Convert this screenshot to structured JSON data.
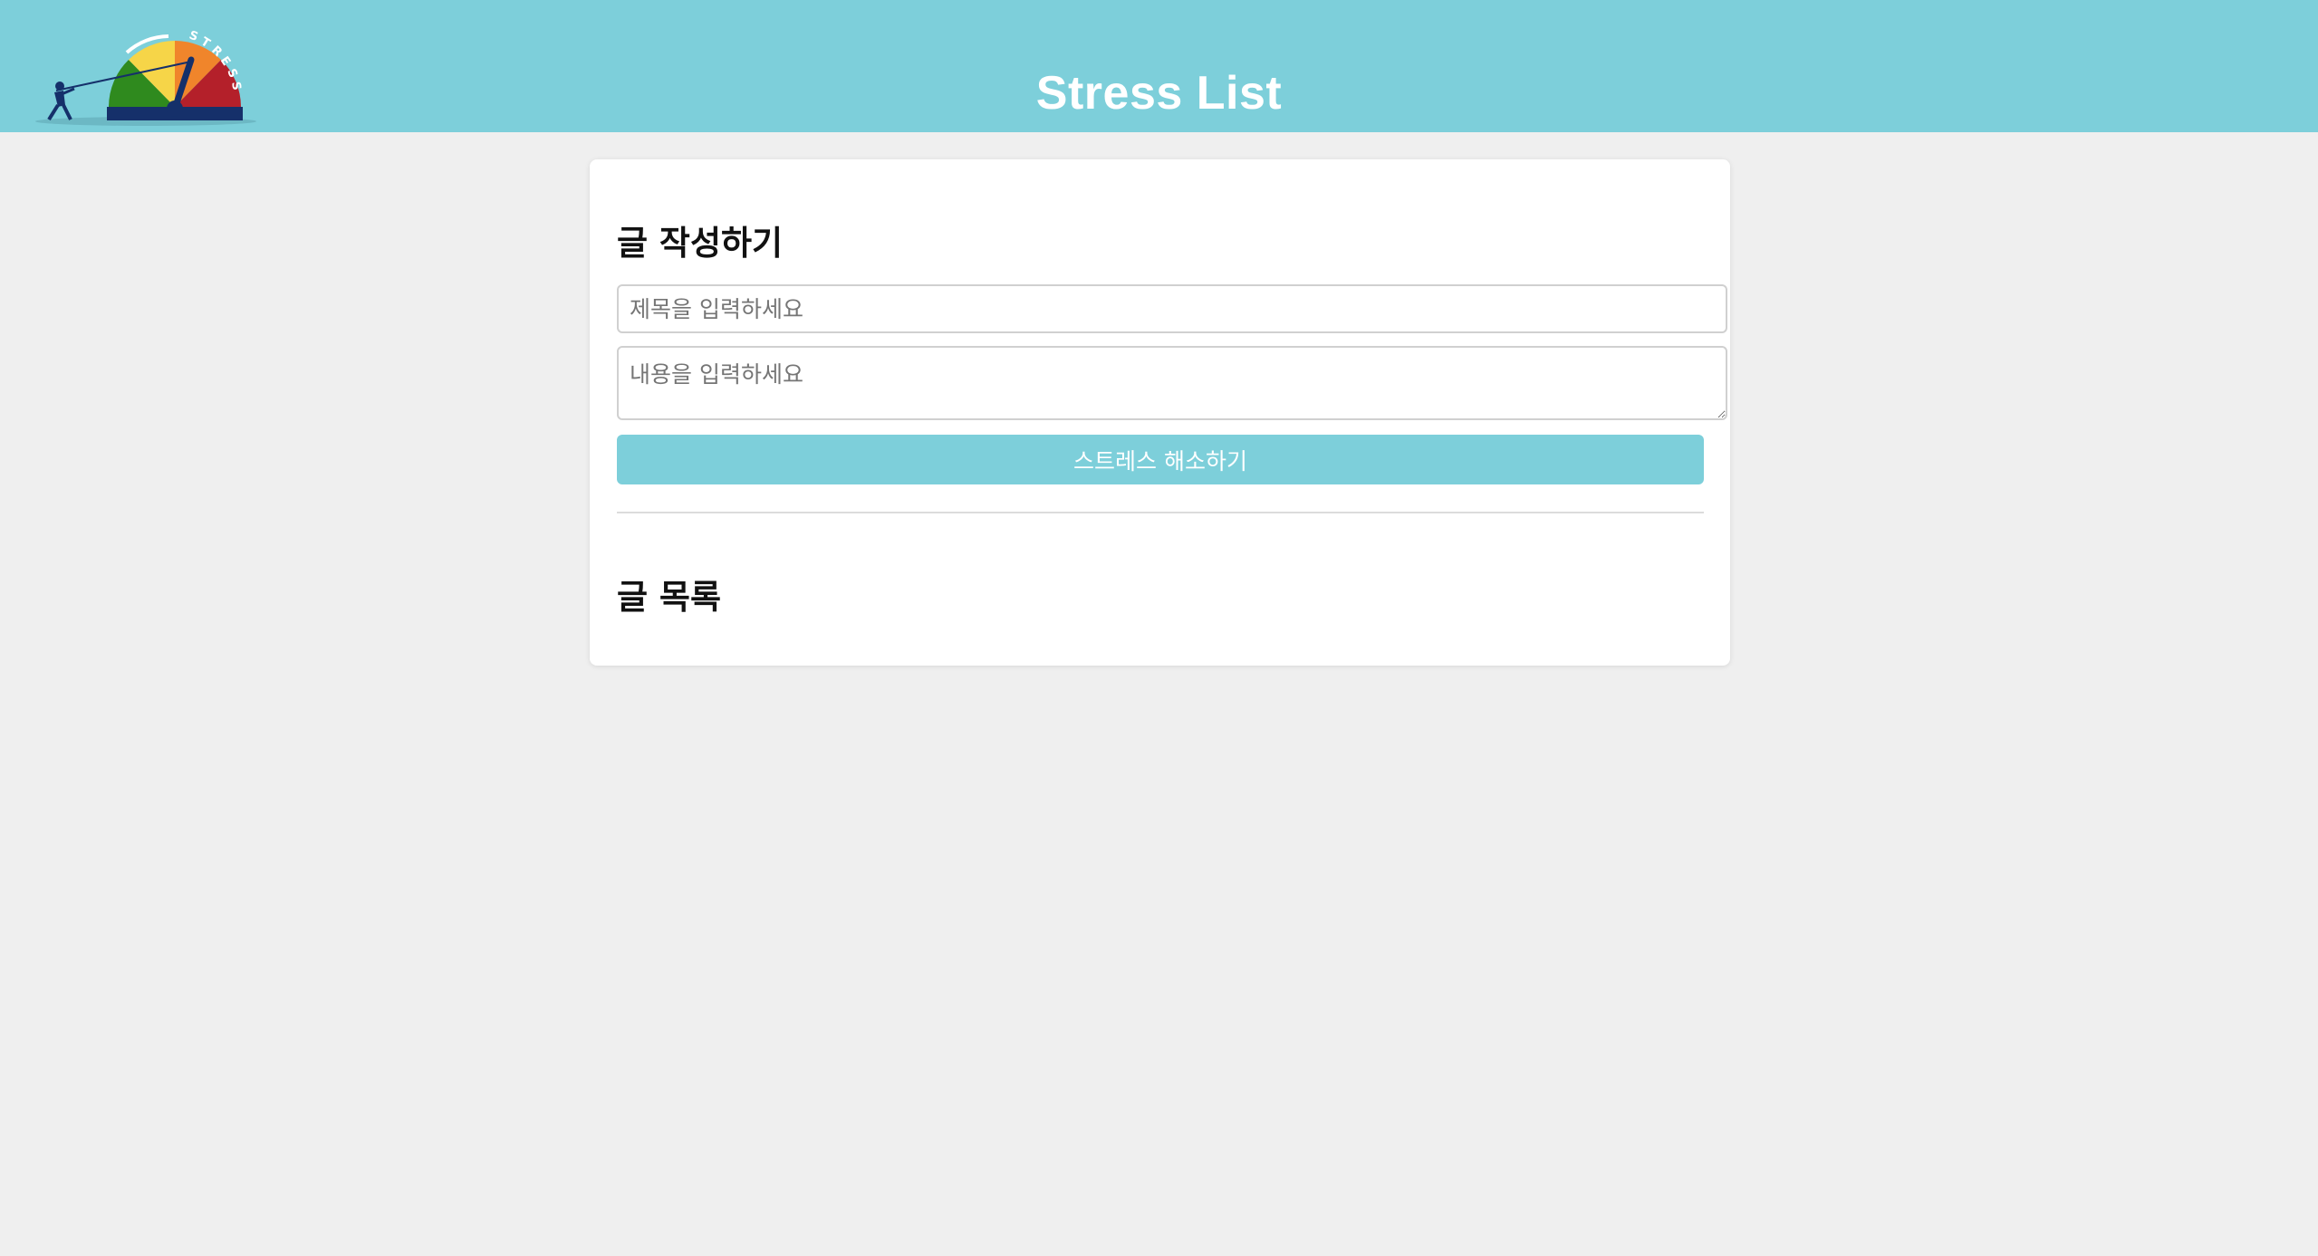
{
  "header": {
    "title": "Stress List",
    "logo": {
      "icon": "stress-gauge-logo",
      "text": "STRESS"
    }
  },
  "write_section": {
    "heading": "글 작성하기",
    "title_placeholder": "제목을 입력하세요",
    "title_value": "",
    "content_placeholder": "내용을 입력하세요",
    "content_value": "",
    "submit_label": "스트레스 해소하기"
  },
  "list_section": {
    "heading": "글 목록",
    "posts": []
  },
  "colors": {
    "accent": "#7dcfda",
    "background": "#efefef",
    "card": "#ffffff"
  }
}
